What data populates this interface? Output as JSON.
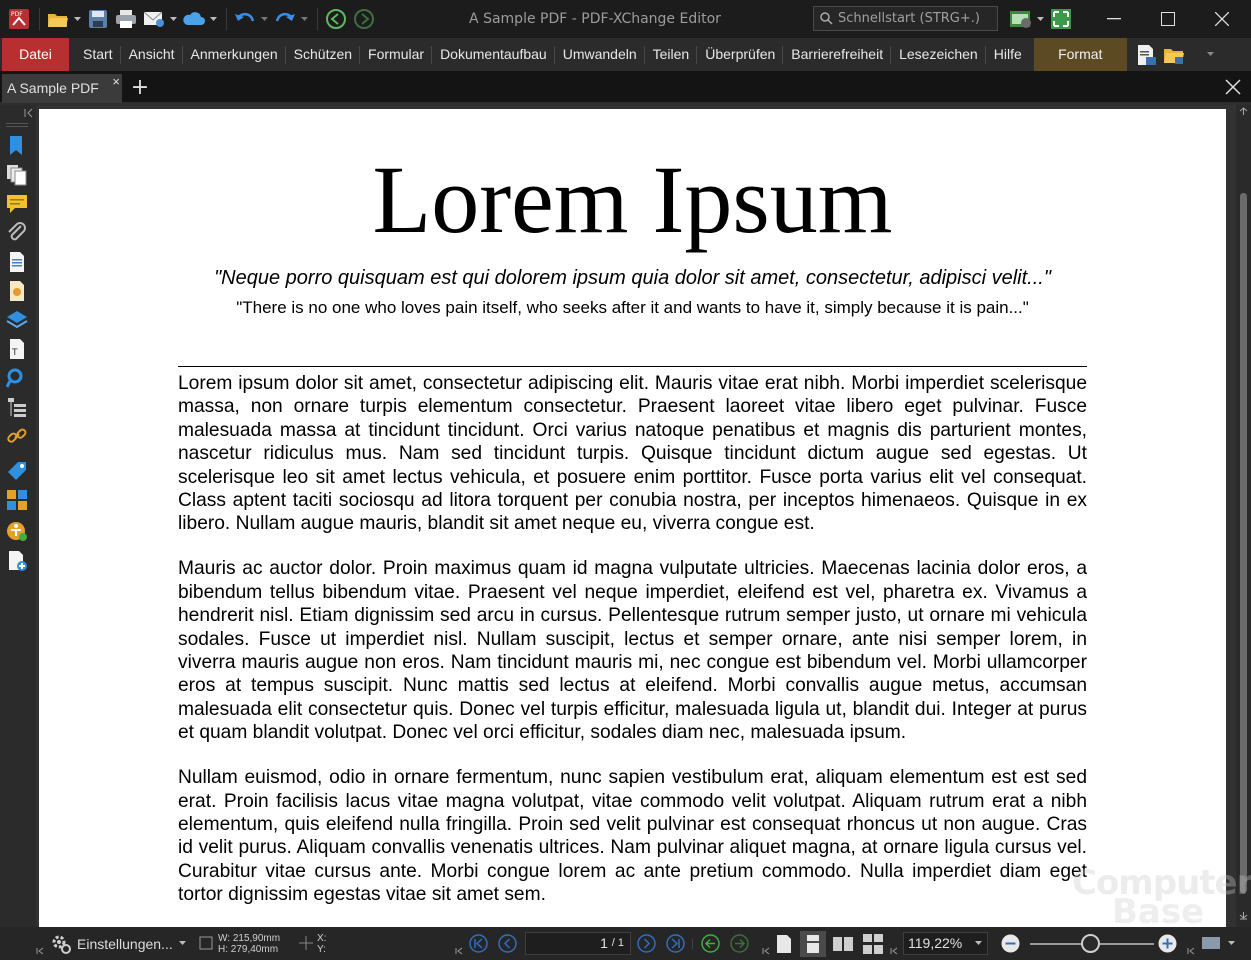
{
  "window": {
    "title": "A Sample PDF - PDF-XChange Editor",
    "search_placeholder": "Schnellstart (STRG+.)",
    "app_icon_label": "PDF"
  },
  "menu": {
    "file": "Datei",
    "tabs": [
      "Start",
      "Ansicht",
      "Anmerkungen",
      "Schützen",
      "Formular",
      "Dokumentaufbau",
      "Umwandeln",
      "Teilen",
      "Überprüfen",
      "Barrierefreiheit",
      "Lesezeichen",
      "Hilfe"
    ],
    "format": "Format"
  },
  "doc_tab": {
    "name": "A Sample PDF",
    "close": "×",
    "new_tab": "+"
  },
  "document": {
    "title": "Lorem Ipsum",
    "quote_latin": "\"Neque porro quisquam est qui dolorem ipsum quia dolor sit amet, consectetur, adipisci velit...\"",
    "quote_english": "\"There is no one who loves pain itself, who seeks after it and wants to have it, simply because it is pain...\"",
    "paragraphs": [
      "Lorem ipsum dolor sit amet, consectetur adipiscing elit. Mauris vitae erat nibh. Morbi imperdiet scelerisque massa, non ornare turpis elementum consectetur. Praesent laoreet vitae libero eget pulvinar. Fusce malesuada massa at tincidunt tincidunt. Orci varius natoque penatibus et magnis dis parturient montes, nascetur ridiculus mus. Nam sed tincidunt turpis. Quisque tincidunt dictum augue sed egestas. Ut scelerisque leo sit amet lectus vehicula, et posuere enim porttitor. Fusce porta varius elit vel consequat. Class aptent taciti sociosqu ad litora torquent per conubia nostra, per inceptos himenaeos. Quisque in ex libero. Nullam augue mauris, blandit sit amet neque eu, viverra congue est.",
      "Mauris ac auctor dolor. Proin maximus quam id magna vulputate ultricies. Maecenas lacinia dolor eros, a bibendum tellus bibendum vitae. Praesent vel neque imperdiet, eleifend est vel, pharetra ex. Vivamus a hendrerit nisl. Etiam dignissim sed arcu in cursus. Pellentesque rutrum semper justo, ut ornare mi vehicula sodales. Fusce ut imperdiet nisl. Nullam suscipit, lectus et semper ornare, ante nisi semper lorem, in viverra mauris augue non eros. Nam tincidunt mauris mi, nec congue est bibendum vel. Morbi ullamcorper eros at tempus suscipit. Nunc mattis sed lectus at eleifend. Morbi convallis augue metus, accumsan malesuada elit consectetur quis. Donec vel turpis efficitur, malesuada ligula ut, blandit dui. Integer at purus et quam blandit volutpat. Donec vel orci efficitur, sodales diam nec, malesuada ipsum.",
      "Nullam euismod, odio in ornare fermentum, nunc sapien vestibulum erat, aliquam elementum est est sed erat. Proin facilisis lacus vitae magna volutpat, vitae commodo velit volutpat. Aliquam rutrum erat a nibh elementum, quis eleifend nulla fringilla. Proin sed velit pulvinar est consequat rhoncus ut non augue. Cras id velit purus. Aliquam convallis venenatis ultrices. Nam pulvinar aliquet magna, at ornare ligula cursus vel. Curabitur vitae cursus ante. Morbi congue lorem ac ante pretium commodo. Nulla imperdiet diam eget tortor dignissim egestas vitae sit amet sem."
    ]
  },
  "status": {
    "settings": "Einstellungen...",
    "width": "W: 215,90mm",
    "height": "H: 279,40mm",
    "x": "X:",
    "y": "Y:",
    "current_page": "1",
    "total_pages": "/ 1",
    "zoom": "119,22%"
  },
  "watermark": {
    "line1": "Computer",
    "line2": "Base"
  },
  "colors": {
    "file_tab": "#b72f2f",
    "format_tab": "#5c4a22",
    "accent_blue": "#2f8fe0",
    "accent_green": "#3fae3f"
  }
}
